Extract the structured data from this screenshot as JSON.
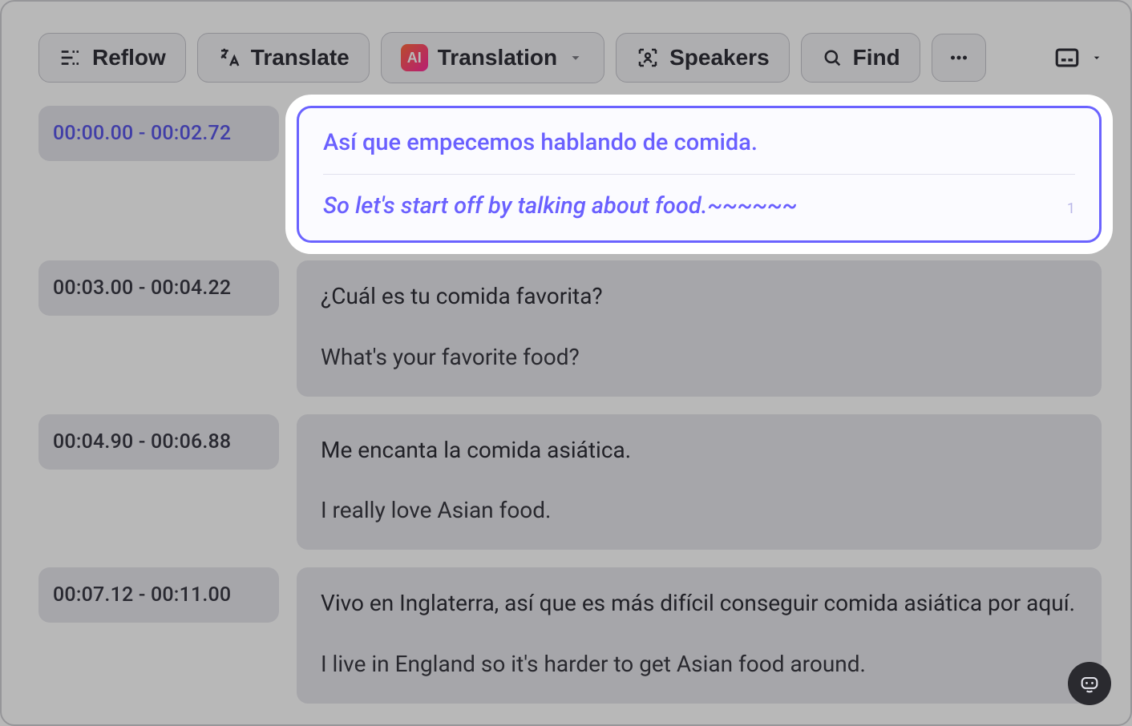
{
  "toolbar": {
    "reflow_label": "Reflow",
    "translate_label": "Translate",
    "translation_label": "Translation",
    "speakers_label": "Speakers",
    "find_label": "Find"
  },
  "segments": [
    {
      "time_from": "00:00.00",
      "time_to": "00:02.72",
      "source": "Así que empecemos hablando de comida.",
      "translation": "So let's start off by talking about food.~~~~~~",
      "index": "1",
      "active": true
    },
    {
      "time_from": "00:03.00",
      "time_to": "00:04.22",
      "source": "¿Cuál es tu comida favorita?",
      "translation": "What's your favorite food?",
      "active": false
    },
    {
      "time_from": "00:04.90",
      "time_to": "00:06.88",
      "source": "Me encanta la comida asiática.",
      "translation": "I really love Asian food.",
      "active": false
    },
    {
      "time_from": "00:07.12",
      "time_to": "00:11.00",
      "source": "Vivo en Inglaterra, así que es más difícil conseguir comida asiática por aquí.",
      "translation": "I live in England so it's harder to get Asian food around.",
      "active": false
    }
  ]
}
